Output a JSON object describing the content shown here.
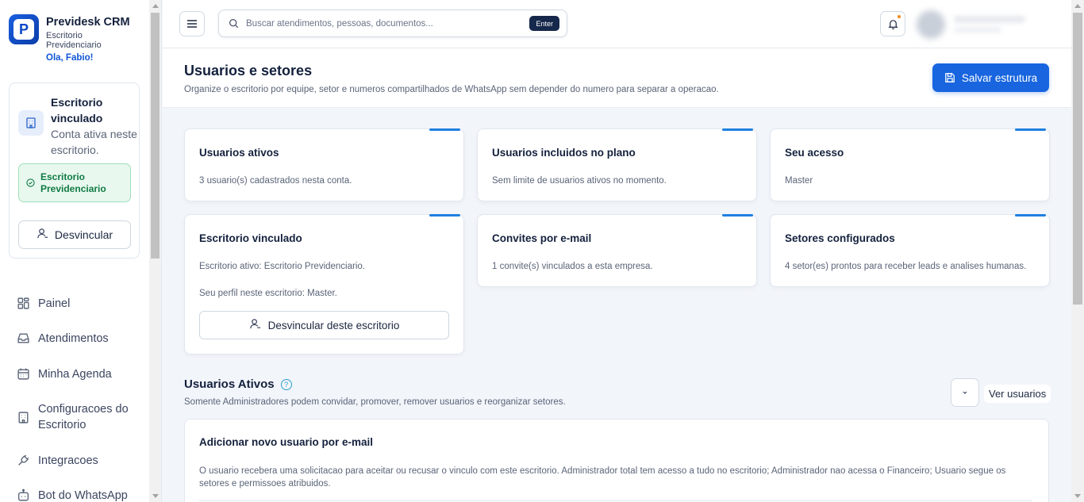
{
  "brand": {
    "logo_letter": "P",
    "name": "Previdesk CRM",
    "subtitle": "Escritorio Previdenciario",
    "greeting": "Ola, Fabio!"
  },
  "office_card": {
    "title": "Escritorio vinculado",
    "description": "Conta ativa neste escritorio.",
    "badge": "Escritorio Previdenciario",
    "unlink_label": "Desvincular"
  },
  "nav": {
    "items": [
      {
        "label": "Painel",
        "icon": "dashboard-icon"
      },
      {
        "label": "Atendimentos",
        "icon": "inbox-icon"
      },
      {
        "label": "Minha Agenda",
        "icon": "calendar-icon"
      },
      {
        "label": "Configuracoes do Escritorio",
        "icon": "building-icon"
      },
      {
        "label": "Integracoes",
        "icon": "plug-icon"
      },
      {
        "label": "Bot do WhatsApp",
        "icon": "bot-icon"
      }
    ]
  },
  "topbar": {
    "search_placeholder": "Buscar atendimentos, pessoas, documentos...",
    "search_key": "Enter"
  },
  "page": {
    "title": "Usuarios e setores",
    "subtitle": "Organize o escritorio por equipe, setor e numeros compartilhados de WhatsApp sem depender do numero para separar a operacao.",
    "save_label": "Salvar estrutura"
  },
  "cards": {
    "active_users": {
      "title": "Usuarios ativos",
      "text": "3 usuario(s) cadastrados nesta conta."
    },
    "plan_users": {
      "title": "Usuarios incluidos no plano",
      "text": "Sem limite de usuarios ativos no momento."
    },
    "access": {
      "title": "Seu acesso",
      "text": "Master"
    },
    "linked_office": {
      "title": "Escritorio vinculado",
      "text1": "Escritorio ativo: Escritorio Previdenciario.",
      "text2": "Seu perfil neste escritorio: Master.",
      "button": "Desvincular deste escritorio"
    },
    "invites": {
      "title": "Convites por e-mail",
      "text": "1 convite(s) vinculados a esta empresa."
    },
    "sectors": {
      "title": "Setores configurados",
      "text": "4 setor(es) prontos para receber leads e analises humanas."
    }
  },
  "active_section": {
    "title": "Usuarios Ativos",
    "help": "?",
    "subtitle": "Somente Administradores podem convidar, promover, remover usuarios e reorganizar setores.",
    "view_label": "Ver usuarios"
  },
  "add_user": {
    "title": "Adicionar novo usuario por e-mail",
    "description": "O usuario recebera uma solicitacao para aceitar ou recusar o vinculo com este escritorio. Administrador total tem acesso a tudo no escritorio; Administrador nao acessa o Financeiro; Usuario segue os setores e permissoes atribuidos."
  },
  "colors": {
    "primary": "#1865df",
    "accent_bar": "#1e7fe0",
    "success_bg": "#e8f8ef",
    "success_text": "#117a43",
    "notification_dot": "#f08a1c"
  }
}
